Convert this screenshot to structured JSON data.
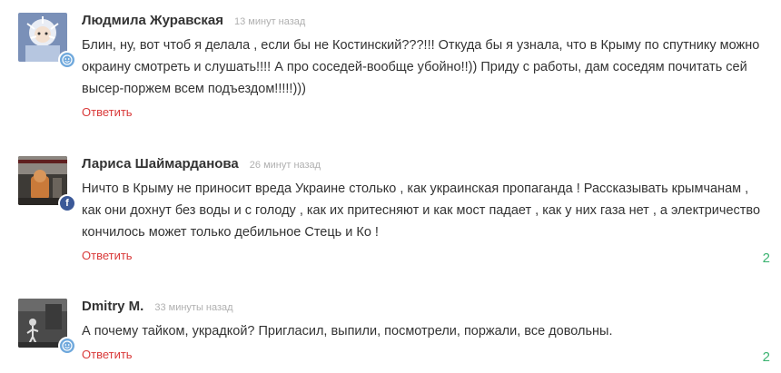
{
  "comments": [
    {
      "author": "Людмила Журавская",
      "time": "13 минут назад",
      "text": "Блин, ну, вот чтоб я делала , если бы не Костинский???!!! Откуда бы я узнала, что в Крыму по спутнику можно окраину смотреть и слушать!!!! А про соседей-вообще убойно!!)) Приду с работы, дам соседям почитать сей высер-поржем всем подъездом!!!!!)))",
      "reply_label": "Ответить",
      "badge": "user-icon",
      "count": ""
    },
    {
      "author": "Лариса Шаймарданова",
      "time": "26 минут назад",
      "text": "Ничто в Крыму не приносит вреда Украине столько , как украинская пропаганда !  Рассказывать крымчанам , как они дохнут без воды и с голоду , как их притесняют и как мост падает , как у них газа нет , а электричество кончилось может только дебильное Стець и Ко !",
      "reply_label": "Ответить",
      "badge": "facebook-icon",
      "count": "2"
    },
    {
      "author": "Dmitry M.",
      "time": "33 минуты назад",
      "text": "А почему тайком, украдкой? Пригласил, выпили, посмотрели, поржали, все довольны.",
      "reply_label": "Ответить",
      "badge": "user-icon",
      "count": "2"
    }
  ],
  "colors": {
    "reply": "#d93a3a",
    "count": "#3cb371",
    "time": "#b0b0b0",
    "badge_user": "#6fa8dc",
    "badge_facebook": "#3b5998"
  }
}
